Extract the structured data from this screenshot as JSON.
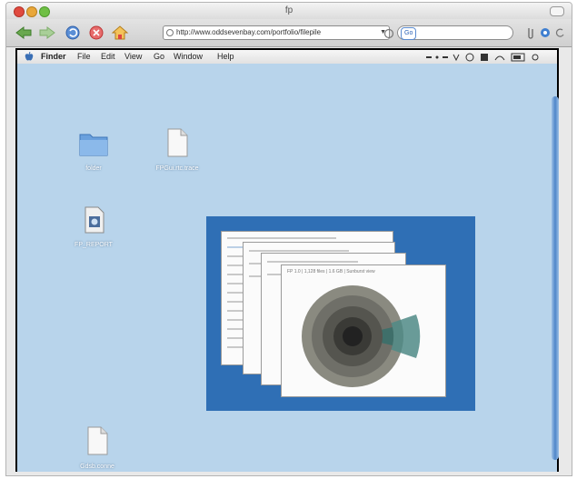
{
  "window": {
    "title": "fp",
    "url": "http://www.oddsevenbay.com/portfolio/filepile",
    "search_engine": "Go"
  },
  "menubar": {
    "items": [
      "Finder",
      "File",
      "Edit",
      "View",
      "Go",
      "Window",
      "Help"
    ]
  },
  "desktop": {
    "icons": [
      {
        "label": "folder",
        "type": "folder-icon"
      },
      {
        "label": "FPGui.rtc.trace",
        "type": "document-icon"
      },
      {
        "label": "FP_REPORT",
        "type": "application-icon"
      },
      {
        "label": "Gdsb.conne",
        "type": "document-icon"
      }
    ]
  },
  "preview": {
    "front_card_title": "FP 1.0   |   1,128 files   |   1.6 GB   |   Sunburst view"
  },
  "colors": {
    "desktop": "#b8d4eb",
    "preview_panel": "#2f6fb5",
    "accent": "#3f6f6a"
  }
}
